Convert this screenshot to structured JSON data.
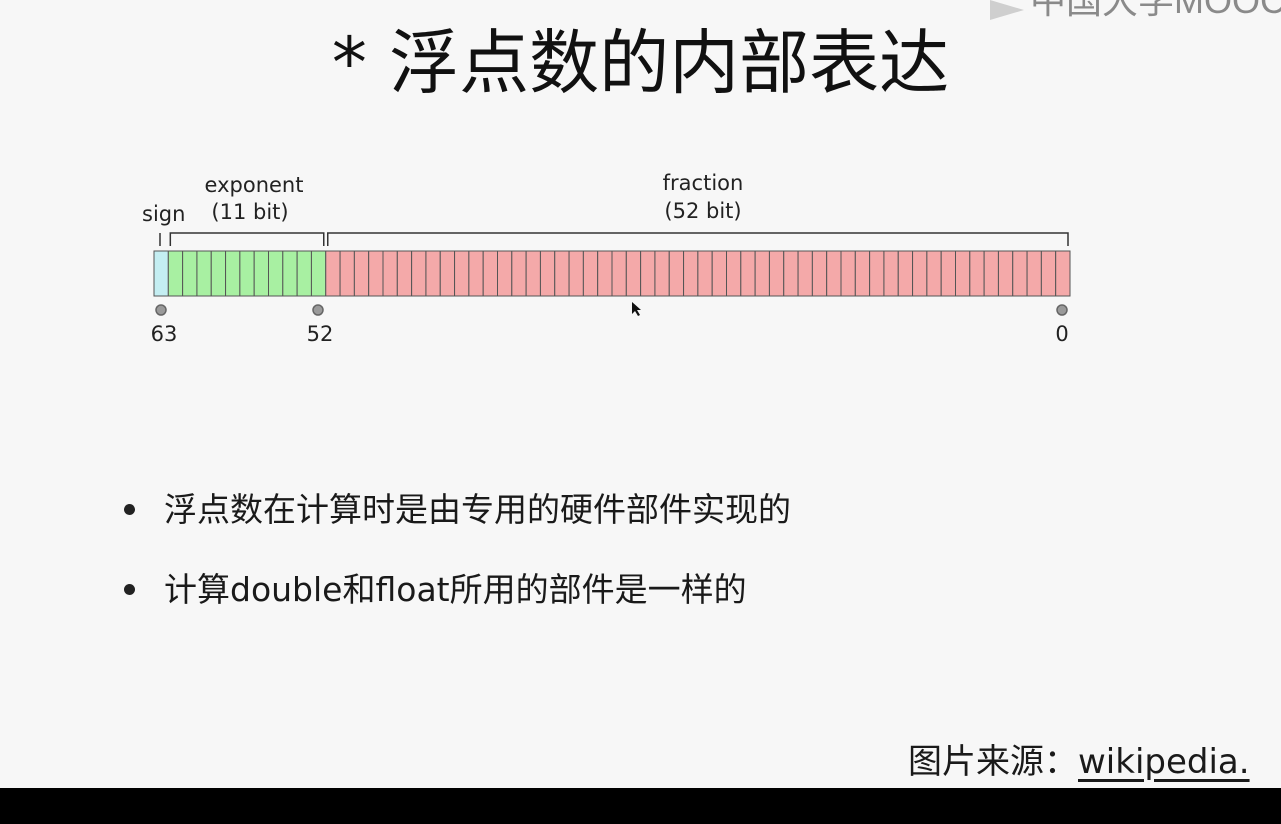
{
  "watermark": {
    "text": "中国大学MOOC"
  },
  "title": "* 浮点数的内部表达",
  "diagram": {
    "sign_label": "sign",
    "exponent_label": "exponent",
    "exponent_bits": "(11 bit)",
    "fraction_label": "fraction",
    "fraction_bits": "(52 bit)",
    "total_bits": 64,
    "sign_bit_count": 1,
    "exponent_bit_count": 11,
    "fraction_bit_count": 52,
    "markers": [
      "63",
      "52",
      "0"
    ],
    "colors": {
      "sign": "#c4eef2",
      "exponent": "#a8f0a2",
      "fraction": "#f4a9a9",
      "border": "#555555",
      "marker": "#999999"
    }
  },
  "bullets": [
    "浮点数在计算时是由专用的硬件部件实现的",
    "计算double和float所用的部件是一样的"
  ],
  "source": {
    "label": "图片来源：",
    "link": "wikipedia."
  }
}
